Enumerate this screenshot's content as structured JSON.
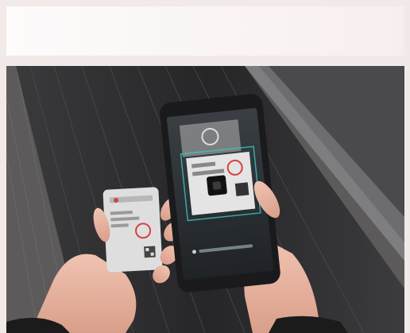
{
  "banner": {
    "text": ""
  },
  "photo": {
    "scene": "hands-holding-card-and-phone-scanning",
    "colors": {
      "escalator": "#2b2b2d",
      "rail": "#5e5e60",
      "floor": "#6b6868",
      "skin": "#e9b8a5",
      "card": "#dcdcdc",
      "stamp": "#d94040",
      "phone": "#1a1a1c"
    }
  }
}
